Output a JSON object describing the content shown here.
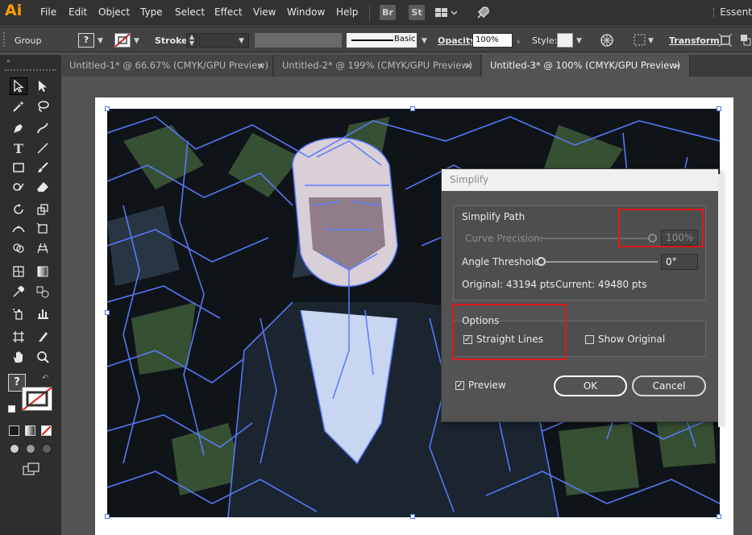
{
  "app": {
    "logo": "Ai",
    "workspace": "Essent"
  },
  "menu": [
    "File",
    "Edit",
    "Object",
    "Type",
    "Select",
    "Effect",
    "View",
    "Window",
    "Help"
  ],
  "menubar_icons": {
    "bridge": "Br",
    "stock": "St"
  },
  "control": {
    "selection_label": "Group",
    "stroke_label": "Stroke:",
    "brush_style": "Basic",
    "opacity_label": "Opacity:",
    "opacity_value": "100%",
    "style_label": "Style:",
    "transform_label": "Transform"
  },
  "tabs": [
    {
      "label": "Untitled-1* @ 66.67% (CMYK/GPU Preview)",
      "close": "×"
    },
    {
      "label": "Untitled-2* @ 199% (CMYK/GPU Preview)",
      "close": "×"
    },
    {
      "label": "Untitled-3* @ 100% (CMYK/GPU Preview)",
      "close": "×"
    }
  ],
  "toolbox": {
    "fill_unknown": "?"
  },
  "dialog": {
    "title": "Simplify",
    "simplify_path_label": "Simplify Path",
    "curve_precision_label": "Curve Precision:",
    "curve_precision_value": "100%",
    "angle_threshold_label": "Angle Threshold:",
    "angle_threshold_value": "0°",
    "original_points": "Original: 43194 pts",
    "current_points": "Current: 49480 pts",
    "options_label": "Options",
    "straight_lines_label": "Straight Lines",
    "straight_lines_checked": true,
    "show_original_label": "Show Original",
    "show_original_checked": false,
    "preview_label": "Preview",
    "preview_checked": true,
    "ok_label": "OK",
    "cancel_label": "Cancel",
    "curve_precision_level": 1.0,
    "angle_threshold_level": 0.0
  },
  "colors": {
    "path_outline": "#5b7bff",
    "highlight": "#e01919",
    "logo": "#ff9a00"
  }
}
